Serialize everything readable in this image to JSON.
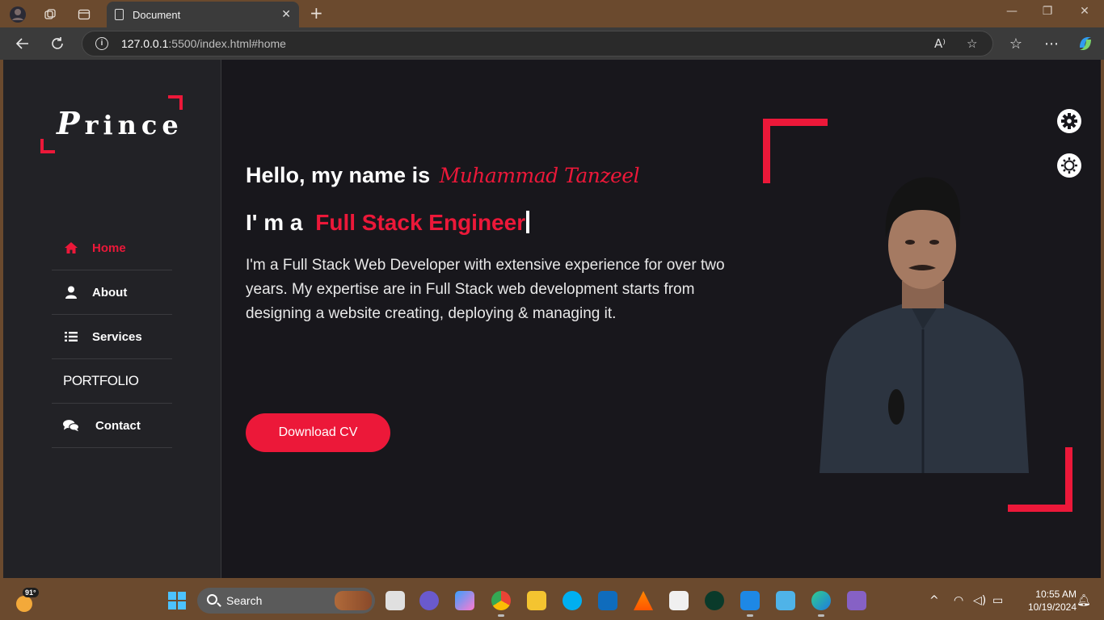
{
  "browser": {
    "tab_title": "Document",
    "url_host": "127.0.0.1",
    "url_rest": ":5500/index.html#home"
  },
  "site": {
    "logo_first": "P",
    "logo_rest": "rince",
    "nav": [
      {
        "label": "Home",
        "icon": "home-icon",
        "active": true
      },
      {
        "label": "About",
        "icon": "user-icon",
        "active": false
      },
      {
        "label": "Services",
        "icon": "list-icon",
        "active": false
      },
      {
        "label": "PORTFOLIO",
        "icon": "",
        "active": false
      },
      {
        "label": "Contact",
        "icon": "comments-icon",
        "active": false
      }
    ],
    "greeting": "Hello, my name is",
    "name": "Muhammad Tanzeel",
    "role_prefix": "I' m a",
    "role": "Full Stack Engineer",
    "description": "I'm a Full Stack Web Developer with extensive experience for over two years. My expertise are in Full Stack web development starts from designing a website creating, deploying & managing it.",
    "cv_button": "Download CV",
    "accent": "#ec1839"
  },
  "taskbar": {
    "temperature": "91°",
    "search_placeholder": "Search",
    "time": "10:55 AM",
    "date": "10/19/2024"
  }
}
